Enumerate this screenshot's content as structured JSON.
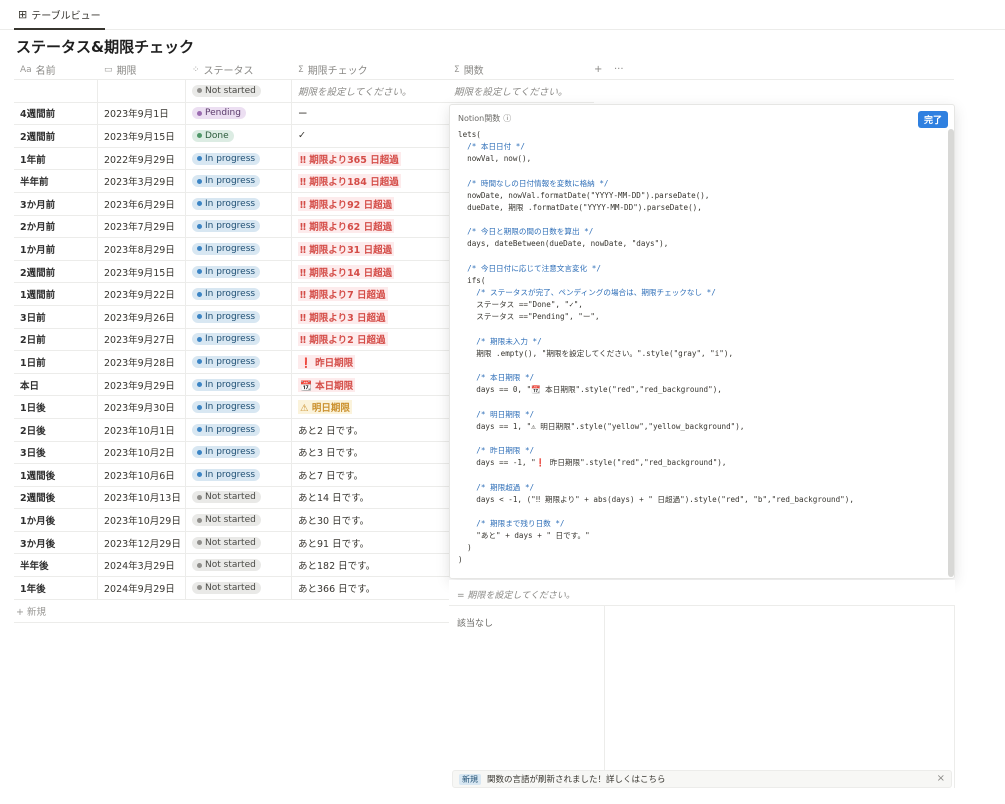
{
  "tab": {
    "icon": "table-icon",
    "label": "テーブルビュー"
  },
  "title": "ステータス&期限チェック",
  "columns": {
    "name": {
      "icon": "Aa",
      "label": "名前"
    },
    "date": {
      "icon": "calendar-icon",
      "label": "期限"
    },
    "status": {
      "icon": "status-icon",
      "label": "ステータス"
    },
    "check": {
      "icon": "Σ",
      "label": "期限チェック"
    },
    "func": {
      "icon": "Σ",
      "label": "関数"
    },
    "add": "+",
    "more": "···"
  },
  "rows": [
    {
      "name": "",
      "date": "",
      "status": "Not started",
      "check": "期限を設定してください。",
      "check_style": "gray",
      "func": "期限を設定してください。"
    },
    {
      "name": "4週間前",
      "date": "2023年9月1日",
      "status": "Pending",
      "check": "ー",
      "check_style": "plain"
    },
    {
      "name": "2週間前",
      "date": "2023年9月15日",
      "status": "Done",
      "check": "✓",
      "check_style": "plain"
    },
    {
      "name": "1年前",
      "date": "2022年9月29日",
      "status": "In progress",
      "check": "‼ 期限より365 日超過",
      "check_style": "red"
    },
    {
      "name": "半年前",
      "date": "2023年3月29日",
      "status": "In progress",
      "check": "‼ 期限より184 日超過",
      "check_style": "red"
    },
    {
      "name": "3か月前",
      "date": "2023年6月29日",
      "status": "In progress",
      "check": "‼ 期限より92 日超過",
      "check_style": "red"
    },
    {
      "name": "2か月前",
      "date": "2023年7月29日",
      "status": "In progress",
      "check": "‼ 期限より62 日超過",
      "check_style": "red"
    },
    {
      "name": "1か月前",
      "date": "2023年8月29日",
      "status": "In progress",
      "check": "‼ 期限より31 日超過",
      "check_style": "red"
    },
    {
      "name": "2週間前",
      "date": "2023年9月15日",
      "status": "In progress",
      "check": "‼ 期限より14 日超過",
      "check_style": "red"
    },
    {
      "name": "1週間前",
      "date": "2023年9月22日",
      "status": "In progress",
      "check": "‼ 期限より7 日超過",
      "check_style": "red"
    },
    {
      "name": "3日前",
      "date": "2023年9月26日",
      "status": "In progress",
      "check": "‼ 期限より3 日超過",
      "check_style": "red"
    },
    {
      "name": "2日前",
      "date": "2023年9月27日",
      "status": "In progress",
      "check": "‼ 期限より2 日超過",
      "check_style": "red"
    },
    {
      "name": "1日前",
      "date": "2023年9月28日",
      "status": "In progress",
      "check": "❗ 昨日期限",
      "check_style": "red"
    },
    {
      "name": "本日",
      "date": "2023年9月29日",
      "status": "In progress",
      "check": "📆 本日期限",
      "check_style": "red"
    },
    {
      "name": "1日後",
      "date": "2023年9月30日",
      "status": "In progress",
      "check": "⚠ 明日期限",
      "check_style": "yellow"
    },
    {
      "name": "2日後",
      "date": "2023年10月1日",
      "status": "In progress",
      "check": "あと2 日です。",
      "check_style": "plain"
    },
    {
      "name": "3日後",
      "date": "2023年10月2日",
      "status": "In progress",
      "check": "あと3 日です。",
      "check_style": "plain"
    },
    {
      "name": "1週間後",
      "date": "2023年10月6日",
      "status": "In progress",
      "check": "あと7 日です。",
      "check_style": "plain"
    },
    {
      "name": "2週間後",
      "date": "2023年10月13日",
      "status": "Not started",
      "check": "あと14 日です。",
      "check_style": "plain"
    },
    {
      "name": "1か月後",
      "date": "2023年10月29日",
      "status": "Not started",
      "check": "あと30 日です。",
      "check_style": "plain"
    },
    {
      "name": "3か月後",
      "date": "2023年12月29日",
      "status": "Not started",
      "check": "あと91 日です。",
      "check_style": "plain"
    },
    {
      "name": "半年後",
      "date": "2024年3月29日",
      "status": "Not started",
      "check": "あと182 日です。",
      "check_style": "plain"
    },
    {
      "name": "1年後",
      "date": "2024年9月29日",
      "status": "Not started",
      "check": "あと366 日です。",
      "check_style": "plain"
    }
  ],
  "new_row": "+ 新規",
  "editor": {
    "title": "Notion関数",
    "help_icon": "ⓘ",
    "done": "完了",
    "code_lines": [
      "lets(",
      "  /* 本日日付 */",
      "  nowVal, now(),",
      "",
      "  /* 時間なしの日付情報を変数に格納 */",
      "  nowDate, nowVal.formatDate(\"YYYY-MM-DD\").parseDate(),",
      "  dueDate, 期限 .formatDate(\"YYYY-MM-DD\").parseDate(),",
      "",
      "  /* 今日と期限の間の日数を算出 */",
      "  days, dateBetween(dueDate, nowDate, \"days\"),",
      "",
      "  /* 今日日付に応じて注意文言変化 */",
      "  ifs(",
      "    /* ステータスが完了、ペンディングの場合は、期限チェックなし */",
      "    ステータス ==\"Done\", \"✓\",",
      "    ステータス ==\"Pending\", \"ー\",",
      "",
      "    /* 期限未入力 */",
      "    期限 .empty(), \"期限を設定してください。\".style(\"gray\", \"i\"),",
      "",
      "    /* 本日期限 */",
      "    days == 0, \"📆 本日期限\".style(\"red\",\"red_background\"),",
      "",
      "    /* 明日期限 */",
      "    days == 1, \"⚠ 明日期限\".style(\"yellow\",\"yellow_background\"),",
      "",
      "    /* 昨日期限 */",
      "    days == -1, \"❗ 昨日期限\".style(\"red\",\"red_background\"),",
      "",
      "    /* 期限超過 */",
      "    days < -1, (\"‼ 期限より\" + abs(days) + \" 日超過\").style(\"red\", \"b\",\"red_background\"),",
      "",
      "    /* 期限まで残り日数 */",
      "    \"あと\" + days + \" 日です。\"",
      "  )",
      ")"
    ],
    "preview": "= 期限を設定してください。",
    "no_match": "該当なし"
  },
  "notice": {
    "badge": "新規",
    "text": "関数の言語が刷新されました！詳しくはこちら",
    "close": "×"
  }
}
